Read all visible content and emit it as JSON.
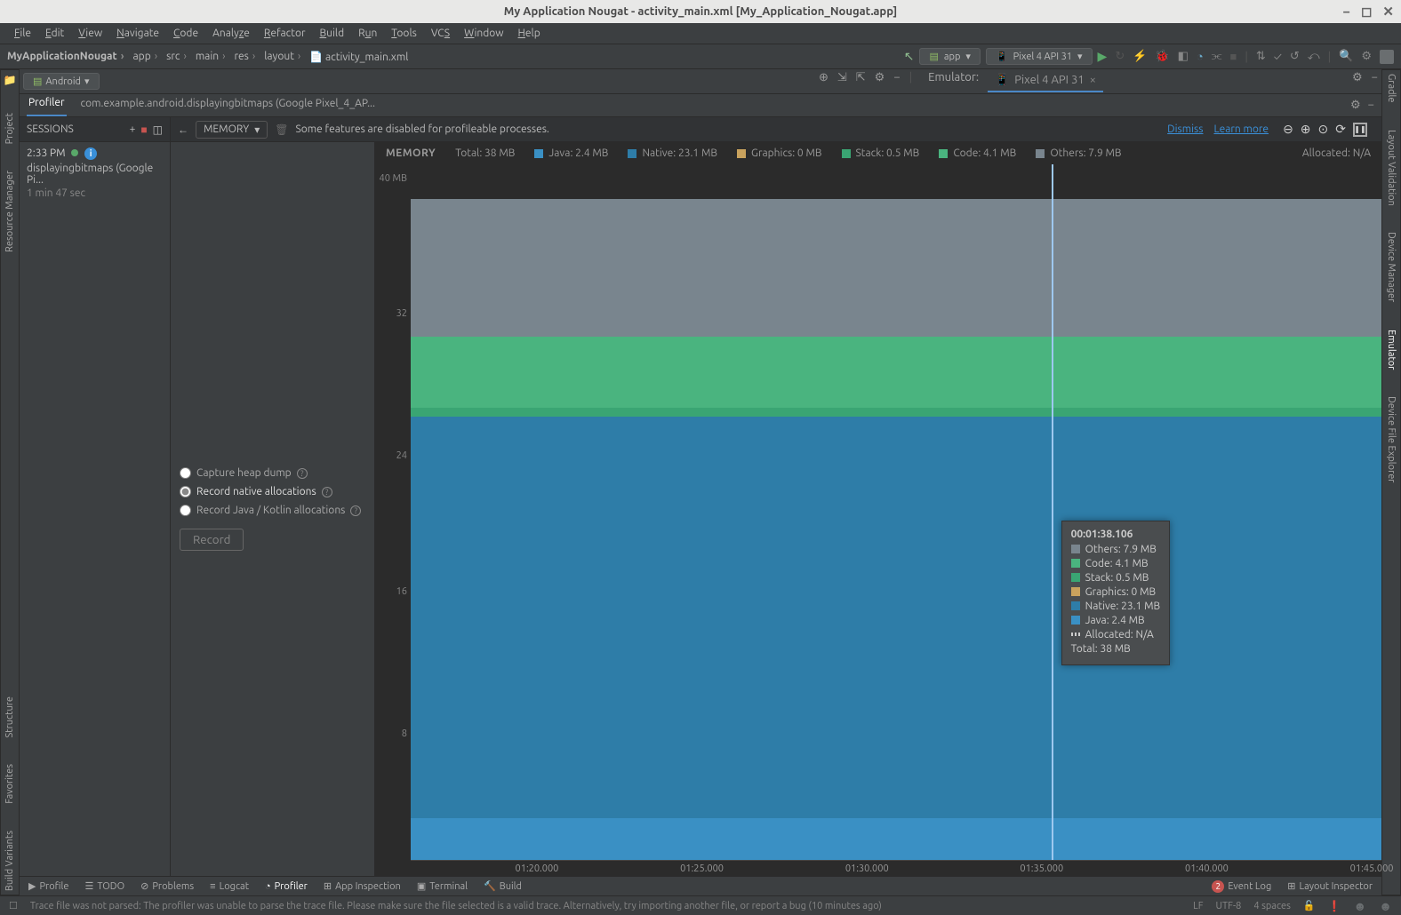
{
  "window_title": "My Application Nougat - activity_main.xml [My_Application_Nougat.app]",
  "menu": [
    "File",
    "Edit",
    "View",
    "Navigate",
    "Code",
    "Analyze",
    "Refactor",
    "Build",
    "Run",
    "Tools",
    "VCS",
    "Window",
    "Help"
  ],
  "breadcrumbs": [
    "MyApplicationNougat",
    "app",
    "src",
    "main",
    "res",
    "layout",
    "activity_main.xml"
  ],
  "run_config": {
    "module": "app",
    "device": "Pixel 4 API 31"
  },
  "left_strip": [
    "Project",
    "Resource Manager",
    "Structure",
    "Favorites",
    "Build Variants"
  ],
  "right_strip": [
    "Gradle",
    "Layout Validation",
    "Device Manager",
    "Emulator",
    "Device File Explorer"
  ],
  "tabs": {
    "active": "Android",
    "emulator_label": "Emulator:",
    "device_tab": "Pixel 4 API 31",
    "separator": "|"
  },
  "profiler": {
    "tabs": {
      "left": "Profiler",
      "process": "com.example.android.displayingbitmaps (Google Pixel_4_AP..."
    },
    "sessions_label": "SESSIONS",
    "memory_dd": "MEMORY",
    "warn": "Some features are disabled for profileable processes.",
    "links": {
      "dismiss": "Dismiss",
      "learn": "Learn more"
    },
    "session": {
      "time": "2:33 PM",
      "name": "displayingbitmaps (Google Pi...",
      "duration": "1 min 47 sec"
    },
    "record_opts": {
      "heap": "Capture heap dump",
      "native": "Record native allocations",
      "java": "Record Java / Kotlin allocations",
      "button": "Record"
    }
  },
  "chart_data": {
    "type": "area",
    "title": "MEMORY",
    "total": "Total: 38 MB",
    "ylim_label": "40 MB",
    "y_ticks": [
      8,
      16,
      24,
      32,
      40
    ],
    "x_ticks": [
      "01:20.000",
      "01:25.000",
      "01:30.000",
      "01:35.000",
      "01:40.000",
      "01:45.000"
    ],
    "series": [
      {
        "name": "Java",
        "value": 2.4,
        "unit": "MB",
        "color": "c-java"
      },
      {
        "name": "Native",
        "value": 23.1,
        "unit": "MB",
        "color": "c-native"
      },
      {
        "name": "Graphics",
        "value": 0,
        "unit": "MB",
        "color": "c-graphics"
      },
      {
        "name": "Stack",
        "value": 0.5,
        "unit": "MB",
        "color": "c-stack"
      },
      {
        "name": "Code",
        "value": 4.1,
        "unit": "MB",
        "color": "c-code"
      },
      {
        "name": "Others",
        "value": 7.9,
        "unit": "MB",
        "color": "c-others"
      }
    ],
    "allocated": "Allocated: N/A",
    "cursor_time": "00:01:38.106",
    "cursor_x_pct": 66
  },
  "tooltip_rows": [
    {
      "color": "c-others",
      "label": "Others: 7.9 MB"
    },
    {
      "color": "c-code",
      "label": "Code: 4.1 MB"
    },
    {
      "color": "c-stack",
      "label": "Stack: 0.5 MB"
    },
    {
      "color": "c-graphics",
      "label": "Graphics: 0 MB"
    },
    {
      "color": "c-native",
      "label": "Native: 23.1 MB"
    },
    {
      "color": "c-java",
      "label": "Java: 2.4 MB"
    }
  ],
  "tooltip_alloc": "Allocated: N/A",
  "tooltip_total": "Total: 38 MB",
  "legend": {
    "java": "Java: 2.4 MB",
    "native": "Native: 23.1 MB",
    "graphics": "Graphics: 0 MB",
    "stack": "Stack: 0.5 MB",
    "code": "Code: 4.1 MB",
    "others": "Others: 7.9 MB"
  },
  "bottom_tabs": [
    "Profile",
    "TODO",
    "Problems",
    "Logcat",
    "Profiler",
    "App Inspection",
    "Terminal",
    "Build"
  ],
  "bottom_right": {
    "event_count": "2",
    "event_log": "Event Log",
    "layout_inspector": "Layout Inspector"
  },
  "status": {
    "msg": "Trace file was not parsed: The profiler was unable to parse the trace file. Please make sure the file selected is a valid trace. Alternatively, try importing another file, or report a bug (10 minutes ago)",
    "line_ending": "LF",
    "encoding": "UTF-8",
    "indent": "4 spaces"
  }
}
